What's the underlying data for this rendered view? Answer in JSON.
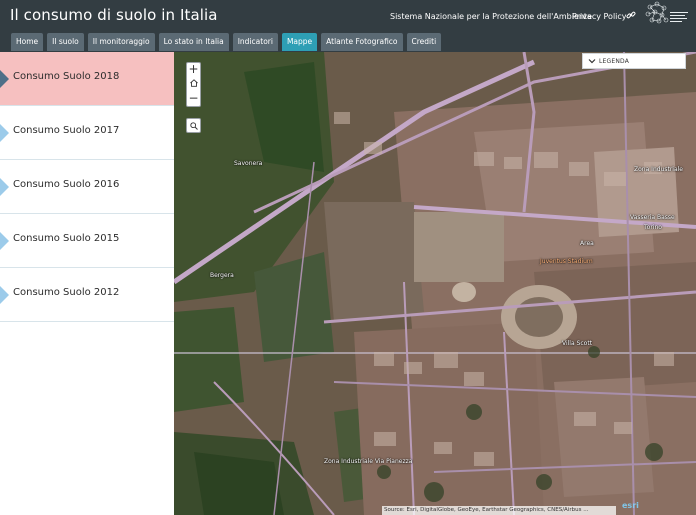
{
  "header": {
    "title": "Il consumo di suolo in Italia",
    "org_link": "Sistema Nazionale per la Protezione dell'Ambiente",
    "privacy_link": "Privacy Policy"
  },
  "tabs": [
    {
      "label": "Home"
    },
    {
      "label": "Il suolo"
    },
    {
      "label": "Il monitoraggio"
    },
    {
      "label": "Lo stato in Italia"
    },
    {
      "label": "Indicatori"
    },
    {
      "label": "Mappe",
      "active": true
    },
    {
      "label": "Atlante Fotografico"
    },
    {
      "label": "Crediti"
    }
  ],
  "sidebar": {
    "items": [
      {
        "label": "Consumo Suolo 2018",
        "active": true
      },
      {
        "label": "Consumo Suolo 2017"
      },
      {
        "label": "Consumo Suolo 2016"
      },
      {
        "label": "Consumo Suolo 2015"
      },
      {
        "label": "Consumo Suolo 2012"
      }
    ]
  },
  "map": {
    "zoom_in": "+",
    "zoom_out": "−",
    "legend_label": "LEGENDA",
    "attribution": "Source: Esri, DigitalGlobe, GeoEye, Earthstar Geographics, CNES/Airbus ...",
    "esri_logo": "esri",
    "labels": {
      "savonera": "Savonera",
      "bergera": "Bergera",
      "stadium": "Juventus Stadium",
      "area": "Area",
      "vasseria": "Vasseria Basse",
      "torino": "Torino",
      "zona_industriale": "Zona Industriale",
      "villa": "Villa Scott",
      "zona_bassa": "Zona Industriale Via Pianezza"
    }
  },
  "icons": {
    "share": "link-icon",
    "home": "home-icon",
    "search": "search-icon",
    "legend_toggle": "chevron-down-icon",
    "logo": "network-logo"
  },
  "colors": {
    "header_bg": "#333d42",
    "tab_bg": "#5b6a74",
    "tab_active_bg": "#2e9fb5",
    "sidebar_active_bg": "#f6c0c0",
    "marker_active": "#4f6f88",
    "marker": "#9ccbea"
  }
}
